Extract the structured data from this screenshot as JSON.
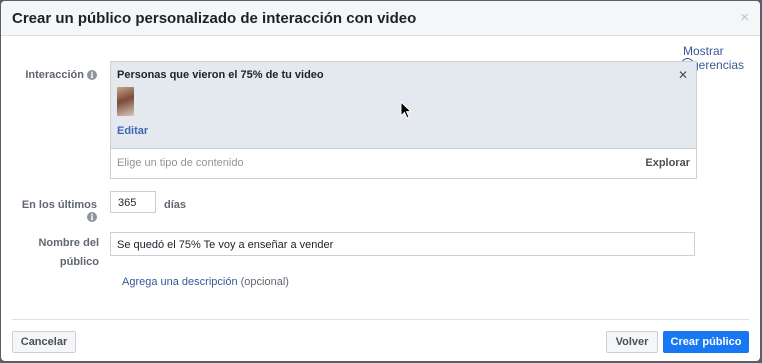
{
  "dialog": {
    "title": "Crear un público personalizado de interacción con video",
    "close_label": "×"
  },
  "side_link": {
    "line1": "Mostrar",
    "line2": "gerencias"
  },
  "interaction": {
    "label": "Interacción",
    "selected_title": "Personas que vieron el 75% de tu video",
    "remove_label": "✕",
    "edit_label": "Editar",
    "type_placeholder": "Elige un tipo de contenido",
    "explore_label": "Explorar"
  },
  "retention": {
    "label": "En los últimos",
    "value": "365",
    "unit": "días"
  },
  "audience_name": {
    "label_line1": "Nombre del",
    "label_line2": "público",
    "value": "Se quedó el 75% Te voy a enseñar a vender"
  },
  "description": {
    "link": "Agrega una descripción",
    "optional": "(opcional)"
  },
  "footer": {
    "cancel": "Cancelar",
    "back": "Volver",
    "create": "Crear público"
  },
  "colors": {
    "accent": "#1877f2",
    "link": "#385898",
    "selected_bg": "#e4e8ef"
  },
  "icons": [
    "info-icon",
    "close-icon",
    "remove-icon",
    "video-thumbnail",
    "mouse-cursor-icon",
    "chevron-left-icon"
  ]
}
